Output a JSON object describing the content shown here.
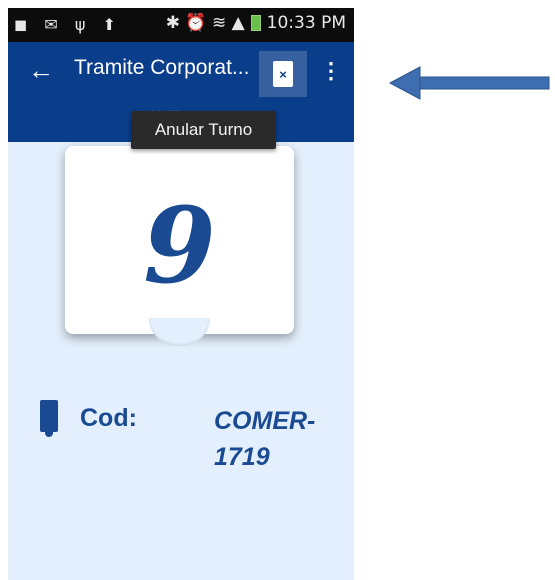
{
  "status_bar": {
    "left_icons": "◼ ✉ ψ ⬆",
    "right_icons": "✱ ⏰ ≋ ▲",
    "time": "10:33 PM"
  },
  "toolbar": {
    "title": "Tramite Corporat...",
    "subtitle": "Mi Turno",
    "cancel_icon": "ticket-cancel-icon",
    "cancel_glyph": "×",
    "overflow": "⋮"
  },
  "tooltip": {
    "text": "Anular Turno"
  },
  "ticket": {
    "number": "9"
  },
  "code": {
    "label": "Cod:",
    "value": "COMER-1719"
  },
  "colors": {
    "primary": "#0a3d8a",
    "background": "#e3effc",
    "arrow": "#3e6db0"
  }
}
